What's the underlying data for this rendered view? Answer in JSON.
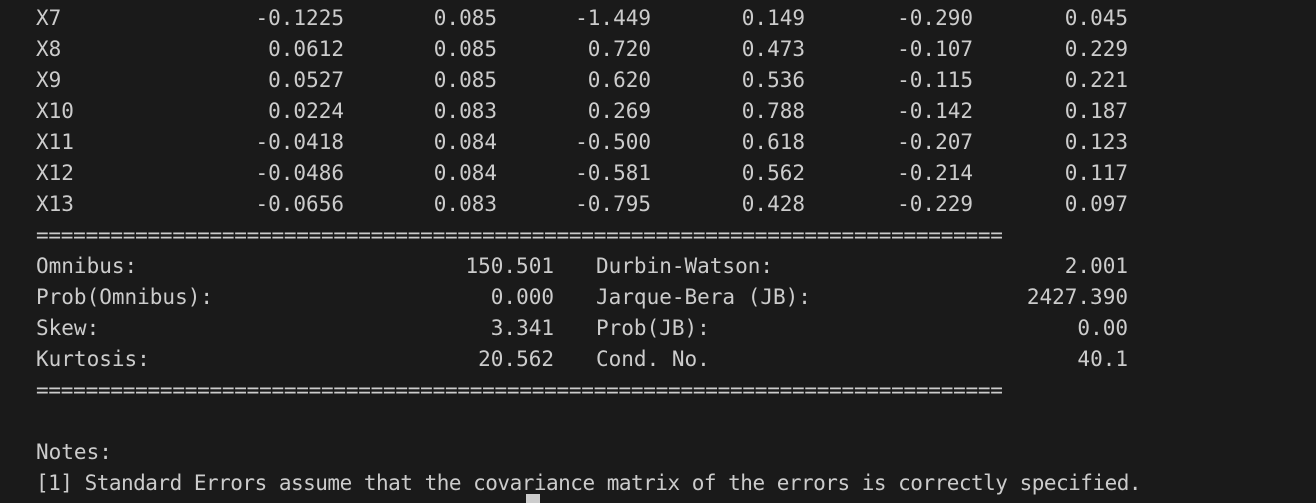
{
  "coef_rows": [
    {
      "name": "X7",
      "coef": "-0.1225",
      "std_err": "0.085",
      "t": "-1.449",
      "p": "0.149",
      "ci_low": "-0.290",
      "ci_high": "0.045"
    },
    {
      "name": "X8",
      "coef": "0.0612",
      "std_err": "0.085",
      "t": "0.720",
      "p": "0.473",
      "ci_low": "-0.107",
      "ci_high": "0.229"
    },
    {
      "name": "X9",
      "coef": "0.0527",
      "std_err": "0.085",
      "t": "0.620",
      "p": "0.536",
      "ci_low": "-0.115",
      "ci_high": "0.221"
    },
    {
      "name": "X10",
      "coef": "0.0224",
      "std_err": "0.083",
      "t": "0.269",
      "p": "0.788",
      "ci_low": "-0.142",
      "ci_high": "0.187"
    },
    {
      "name": "X11",
      "coef": "-0.0418",
      "std_err": "0.084",
      "t": "-0.500",
      "p": "0.618",
      "ci_low": "-0.207",
      "ci_high": "0.123"
    },
    {
      "name": "X12",
      "coef": "-0.0486",
      "std_err": "0.084",
      "t": "-0.581",
      "p": "0.562",
      "ci_low": "-0.214",
      "ci_high": "0.117"
    },
    {
      "name": "X13",
      "coef": "-0.0656",
      "std_err": "0.083",
      "t": "-0.795",
      "p": "0.428",
      "ci_low": "-0.229",
      "ci_high": "0.097"
    }
  ],
  "separator": "==============================================================================",
  "stats_rows": [
    {
      "left_label": "Omnibus:",
      "left_value": "150.501",
      "right_label": "Durbin-Watson:",
      "right_value": "2.001"
    },
    {
      "left_label": "Prob(Omnibus):",
      "left_value": "0.000",
      "right_label": "Jarque-Bera (JB):",
      "right_value": "2427.390"
    },
    {
      "left_label": "Skew:",
      "left_value": "3.341",
      "right_label": "Prob(JB):",
      "right_value": "0.00"
    },
    {
      "left_label": "Kurtosis:",
      "left_value": "20.562",
      "right_label": "Cond. No.",
      "right_value": "40.1"
    }
  ],
  "notes": {
    "heading": "Notes:",
    "line1": "[1] Standard Errors assume that the covariance matrix of the errors is correctly specified."
  }
}
